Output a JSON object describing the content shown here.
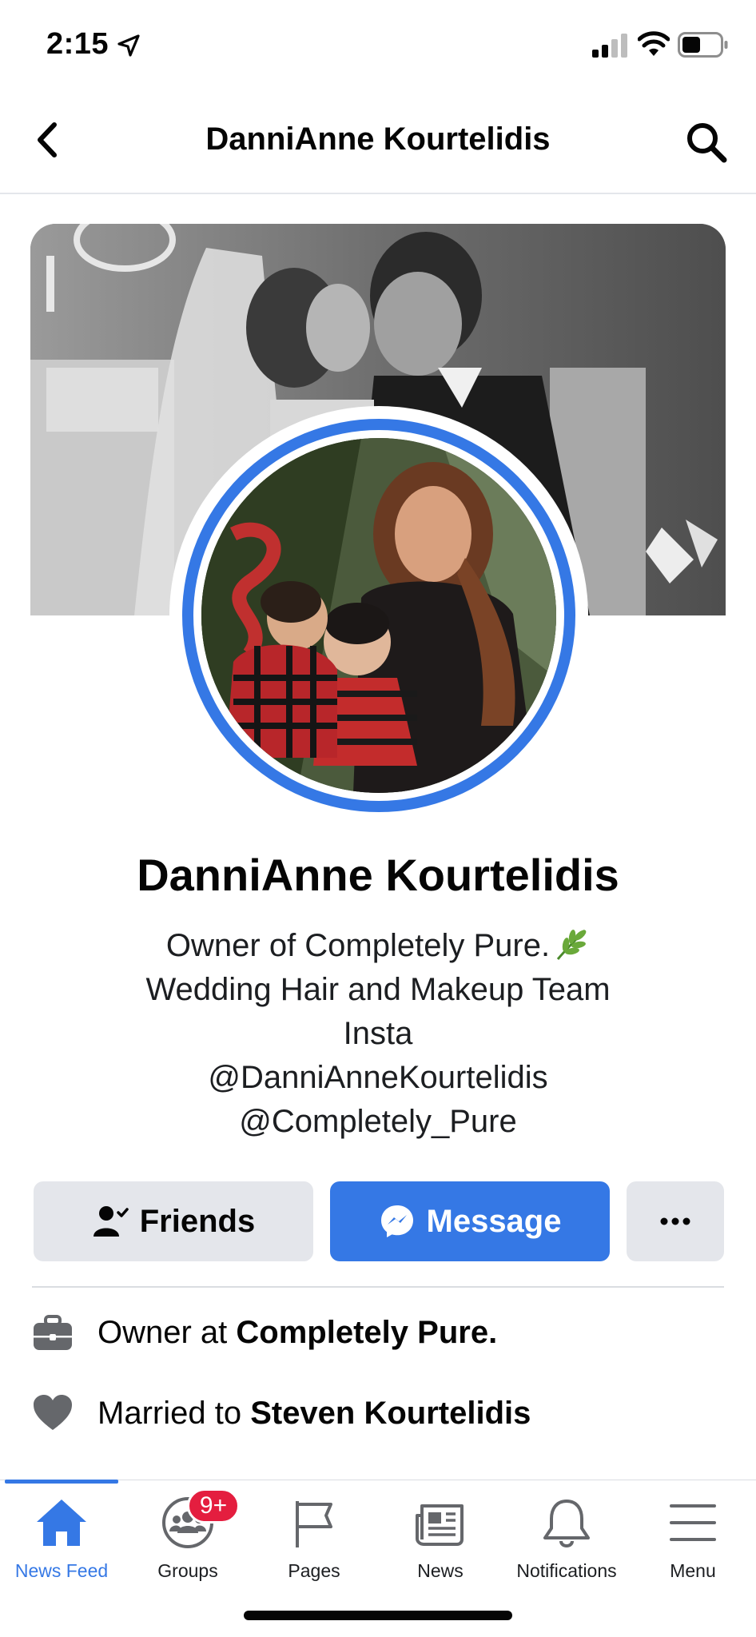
{
  "status_bar": {
    "time": "2:15"
  },
  "nav": {
    "title": "DanniAnne Kourtelidis"
  },
  "profile": {
    "name": "DanniAnne Kourtelidis",
    "bio": [
      "Owner of Completely Pure.",
      "Wedding Hair and Makeup Team",
      "Insta",
      "@DanniAnneKourtelidis",
      "@Completely_Pure"
    ]
  },
  "actions": {
    "friends_label": "Friends",
    "message_label": "Message",
    "more_label": "···"
  },
  "info": [
    {
      "prefix": "Owner at ",
      "value": "Completely Pure.",
      "icon": "briefcase-icon"
    },
    {
      "prefix": "Married to ",
      "value": "Steven Kourtelidis",
      "icon": "heart-icon"
    }
  ],
  "tabs": [
    {
      "label": "News Feed",
      "icon": "home-icon",
      "active": true
    },
    {
      "label": "Groups",
      "icon": "groups-icon",
      "badge": "9+"
    },
    {
      "label": "Pages",
      "icon": "flag-icon"
    },
    {
      "label": "News",
      "icon": "newspaper-icon"
    },
    {
      "label": "Notifications",
      "icon": "bell-icon"
    },
    {
      "label": "Menu",
      "icon": "menu-icon"
    }
  ],
  "colors": {
    "accent": "#3578e5",
    "button_gray": "#e4e6eb",
    "badge_red": "#e41e3f"
  }
}
